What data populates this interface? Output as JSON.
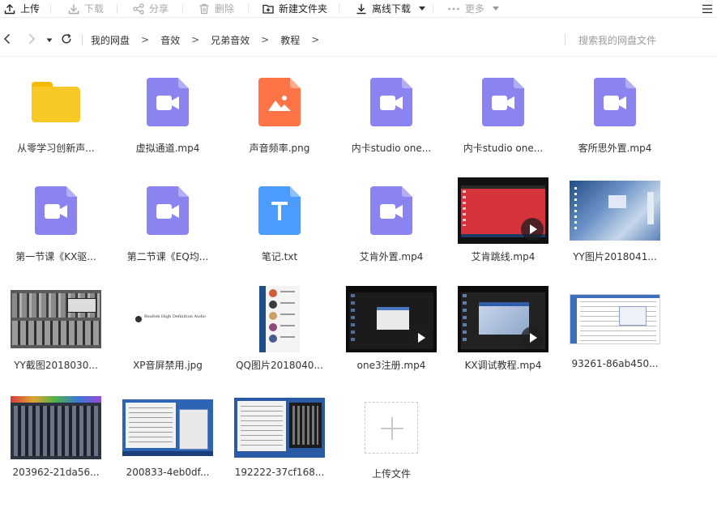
{
  "toolbar": {
    "upload": "上传",
    "download": "下载",
    "share": "分享",
    "delete": "删除",
    "new_folder": "新建文件夹",
    "offline_download": "离线下载",
    "more": "更多"
  },
  "nav": {
    "breadcrumbs": [
      "我的网盘",
      "音效",
      "兄弟音效",
      "教程"
    ],
    "search_placeholder": "搜索我的网盘文件"
  },
  "files": [
    {
      "name": "从零学习创新声...",
      "type": "folder"
    },
    {
      "name": "虚拟通道.mp4",
      "type": "video"
    },
    {
      "name": "声音频率.png",
      "type": "image"
    },
    {
      "name": "内卡studio one...",
      "type": "video"
    },
    {
      "name": "内卡studio one...",
      "type": "video"
    },
    {
      "name": "客所思外置.mp4",
      "type": "video"
    },
    {
      "name": "第一节课《KX驱...",
      "type": "video"
    },
    {
      "name": "第二节课《EQ均...",
      "type": "video"
    },
    {
      "name": "笔记.txt",
      "type": "text"
    },
    {
      "name": "艾肯外置.mp4",
      "type": "video"
    },
    {
      "name": "艾肯跳线.mp4",
      "type": "video-thumb"
    },
    {
      "name": "YY图片2018041...",
      "type": "image-thumb"
    },
    {
      "name": "YY截图2018030...",
      "type": "image-thumb"
    },
    {
      "name": "XP音屏禁用.jpg",
      "type": "image-thumb"
    },
    {
      "name": "QQ图片2018040...",
      "type": "image-thumb"
    },
    {
      "name": "one3注册.mp4",
      "type": "video-thumb"
    },
    {
      "name": "KX调试教程.mp4",
      "type": "video-thumb"
    },
    {
      "name": "93261-86ab450...",
      "type": "image-thumb"
    },
    {
      "name": "203962-21da56...",
      "type": "image-thumb"
    },
    {
      "name": "200833-4eb0df...",
      "type": "image-thumb"
    },
    {
      "name": "192222-37cf168...",
      "type": "image-thumb"
    }
  ],
  "upload_tile": {
    "label": "上传文件"
  },
  "thumb_text": {
    "xp_banner": "Realtek High Definition Audio"
  },
  "colors": {
    "video": "#8b83f0",
    "image": "#ff7446",
    "text": "#4c9bff",
    "folder": "#f8c926"
  }
}
